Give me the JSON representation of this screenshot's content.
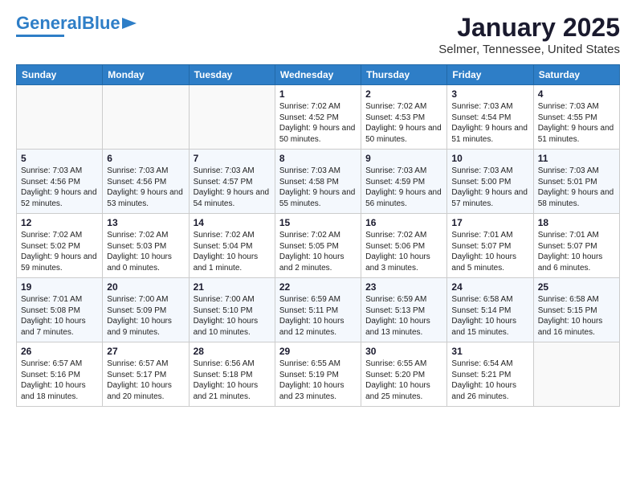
{
  "header": {
    "logo_general": "General",
    "logo_blue": "Blue",
    "title": "January 2025",
    "subtitle": "Selmer, Tennessee, United States"
  },
  "weekdays": [
    "Sunday",
    "Monday",
    "Tuesday",
    "Wednesday",
    "Thursday",
    "Friday",
    "Saturday"
  ],
  "weeks": [
    [
      {
        "day": "",
        "info": ""
      },
      {
        "day": "",
        "info": ""
      },
      {
        "day": "",
        "info": ""
      },
      {
        "day": "1",
        "info": "Sunrise: 7:02 AM\nSunset: 4:52 PM\nDaylight: 9 hours and 50 minutes."
      },
      {
        "day": "2",
        "info": "Sunrise: 7:02 AM\nSunset: 4:53 PM\nDaylight: 9 hours and 50 minutes."
      },
      {
        "day": "3",
        "info": "Sunrise: 7:03 AM\nSunset: 4:54 PM\nDaylight: 9 hours and 51 minutes."
      },
      {
        "day": "4",
        "info": "Sunrise: 7:03 AM\nSunset: 4:55 PM\nDaylight: 9 hours and 51 minutes."
      }
    ],
    [
      {
        "day": "5",
        "info": "Sunrise: 7:03 AM\nSunset: 4:56 PM\nDaylight: 9 hours and 52 minutes."
      },
      {
        "day": "6",
        "info": "Sunrise: 7:03 AM\nSunset: 4:56 PM\nDaylight: 9 hours and 53 minutes."
      },
      {
        "day": "7",
        "info": "Sunrise: 7:03 AM\nSunset: 4:57 PM\nDaylight: 9 hours and 54 minutes."
      },
      {
        "day": "8",
        "info": "Sunrise: 7:03 AM\nSunset: 4:58 PM\nDaylight: 9 hours and 55 minutes."
      },
      {
        "day": "9",
        "info": "Sunrise: 7:03 AM\nSunset: 4:59 PM\nDaylight: 9 hours and 56 minutes."
      },
      {
        "day": "10",
        "info": "Sunrise: 7:03 AM\nSunset: 5:00 PM\nDaylight: 9 hours and 57 minutes."
      },
      {
        "day": "11",
        "info": "Sunrise: 7:03 AM\nSunset: 5:01 PM\nDaylight: 9 hours and 58 minutes."
      }
    ],
    [
      {
        "day": "12",
        "info": "Sunrise: 7:02 AM\nSunset: 5:02 PM\nDaylight: 9 hours and 59 minutes."
      },
      {
        "day": "13",
        "info": "Sunrise: 7:02 AM\nSunset: 5:03 PM\nDaylight: 10 hours and 0 minutes."
      },
      {
        "day": "14",
        "info": "Sunrise: 7:02 AM\nSunset: 5:04 PM\nDaylight: 10 hours and 1 minute."
      },
      {
        "day": "15",
        "info": "Sunrise: 7:02 AM\nSunset: 5:05 PM\nDaylight: 10 hours and 2 minutes."
      },
      {
        "day": "16",
        "info": "Sunrise: 7:02 AM\nSunset: 5:06 PM\nDaylight: 10 hours and 3 minutes."
      },
      {
        "day": "17",
        "info": "Sunrise: 7:01 AM\nSunset: 5:07 PM\nDaylight: 10 hours and 5 minutes."
      },
      {
        "day": "18",
        "info": "Sunrise: 7:01 AM\nSunset: 5:07 PM\nDaylight: 10 hours and 6 minutes."
      }
    ],
    [
      {
        "day": "19",
        "info": "Sunrise: 7:01 AM\nSunset: 5:08 PM\nDaylight: 10 hours and 7 minutes."
      },
      {
        "day": "20",
        "info": "Sunrise: 7:00 AM\nSunset: 5:09 PM\nDaylight: 10 hours and 9 minutes."
      },
      {
        "day": "21",
        "info": "Sunrise: 7:00 AM\nSunset: 5:10 PM\nDaylight: 10 hours and 10 minutes."
      },
      {
        "day": "22",
        "info": "Sunrise: 6:59 AM\nSunset: 5:11 PM\nDaylight: 10 hours and 12 minutes."
      },
      {
        "day": "23",
        "info": "Sunrise: 6:59 AM\nSunset: 5:13 PM\nDaylight: 10 hours and 13 minutes."
      },
      {
        "day": "24",
        "info": "Sunrise: 6:58 AM\nSunset: 5:14 PM\nDaylight: 10 hours and 15 minutes."
      },
      {
        "day": "25",
        "info": "Sunrise: 6:58 AM\nSunset: 5:15 PM\nDaylight: 10 hours and 16 minutes."
      }
    ],
    [
      {
        "day": "26",
        "info": "Sunrise: 6:57 AM\nSunset: 5:16 PM\nDaylight: 10 hours and 18 minutes."
      },
      {
        "day": "27",
        "info": "Sunrise: 6:57 AM\nSunset: 5:17 PM\nDaylight: 10 hours and 20 minutes."
      },
      {
        "day": "28",
        "info": "Sunrise: 6:56 AM\nSunset: 5:18 PM\nDaylight: 10 hours and 21 minutes."
      },
      {
        "day": "29",
        "info": "Sunrise: 6:55 AM\nSunset: 5:19 PM\nDaylight: 10 hours and 23 minutes."
      },
      {
        "day": "30",
        "info": "Sunrise: 6:55 AM\nSunset: 5:20 PM\nDaylight: 10 hours and 25 minutes."
      },
      {
        "day": "31",
        "info": "Sunrise: 6:54 AM\nSunset: 5:21 PM\nDaylight: 10 hours and 26 minutes."
      },
      {
        "day": "",
        "info": ""
      }
    ]
  ]
}
